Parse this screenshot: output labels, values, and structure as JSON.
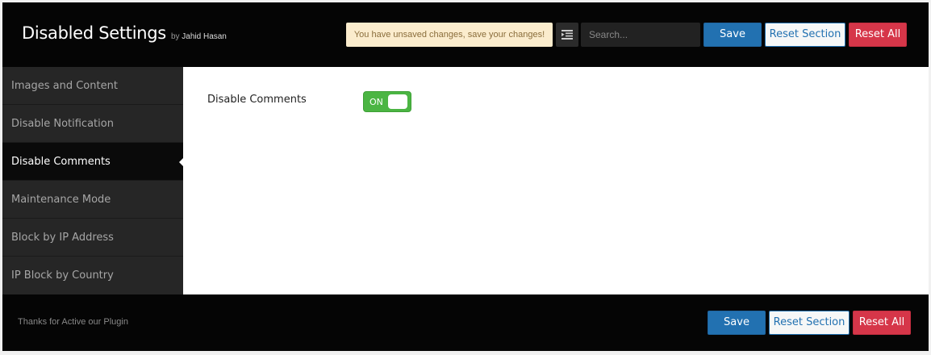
{
  "header": {
    "title": "Disabled Settings",
    "by_text": "by",
    "author": "Jahid Hasan",
    "notice": "You have unsaved changes, save your changes!",
    "expand_icon": "expand-options-icon",
    "search_placeholder": "Search...",
    "save_label": "Save",
    "reset_section_label": "Reset Section",
    "reset_all_label": "Reset All"
  },
  "sidebar": {
    "items": [
      {
        "label": "Images and Content",
        "active": false
      },
      {
        "label": "Disable Notification",
        "active": false
      },
      {
        "label": "Disable Comments",
        "active": true
      },
      {
        "label": "Maintenance Mode",
        "active": false
      },
      {
        "label": "Block by IP Address",
        "active": false
      },
      {
        "label": "IP Block by Country",
        "active": false
      }
    ]
  },
  "content": {
    "field_label": "Disable Comments",
    "toggle_text": "ON",
    "toggle_state": true
  },
  "footer": {
    "thanks": "Thanks for Active our Plugin",
    "save_label": "Save",
    "reset_section_label": "Reset Section",
    "reset_all_label": "Reset All"
  },
  "colors": {
    "header_bg": "#050505",
    "sidebar_bg": "#262626",
    "primary": "#2271b1",
    "danger": "#d63649",
    "toggle_on": "#4bb543",
    "notice_bg": "#fbeccd"
  }
}
